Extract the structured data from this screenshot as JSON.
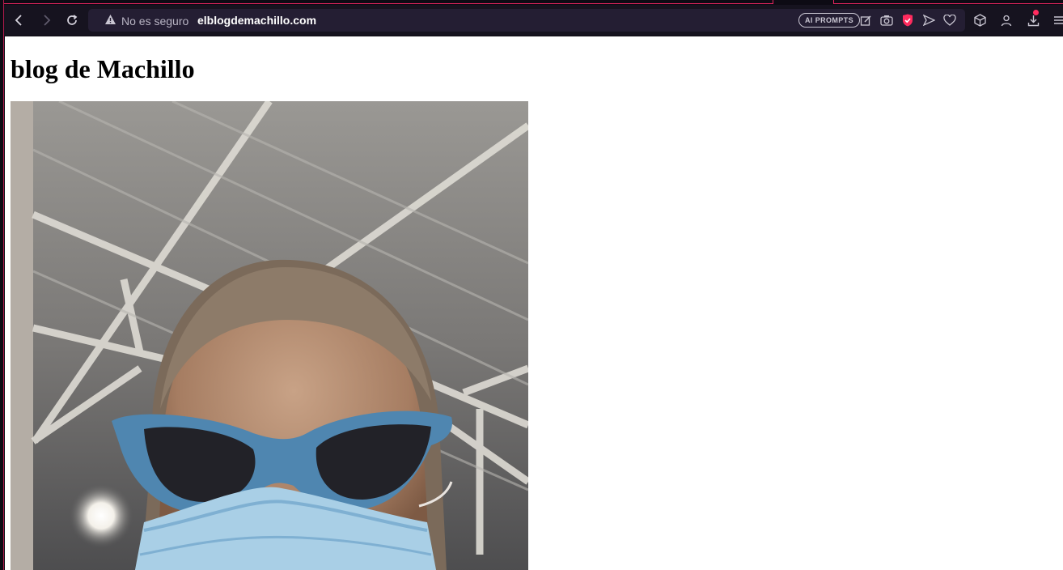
{
  "browser": {
    "security_label": "No es seguro",
    "url": "elblogdemachillo.com",
    "ai_prompts_label": "AI PROMPTS",
    "accent_color": "#e0245e",
    "shield_color": "#ff2b5e"
  },
  "page": {
    "heading": "blog de Machillo",
    "image": {
      "description_icon": "selfie-photo",
      "subject": "person with blue cat-eye sunglasses and surgical mask"
    }
  }
}
